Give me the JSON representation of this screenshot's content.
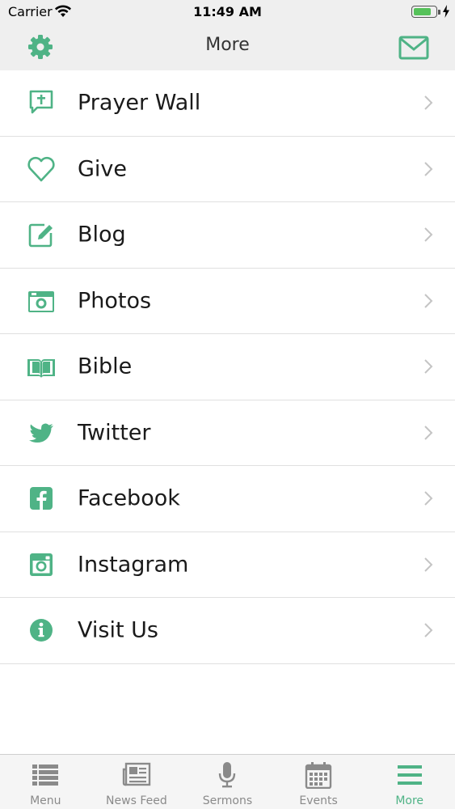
{
  "status_bar": {
    "carrier": "Carrier",
    "time": "11:49 AM",
    "battery_level": 0.7
  },
  "nav": {
    "title": "More",
    "left_icon": "gear-icon",
    "right_icon": "mail-icon"
  },
  "colors": {
    "accent": "#4fb386",
    "inactive": "#8a8a8a",
    "chevron": "#c4c4c4",
    "bar_bg": "#efefef"
  },
  "list": {
    "items": [
      {
        "label": "Prayer Wall",
        "icon": "prayer-bubble-icon"
      },
      {
        "label": "Give",
        "icon": "heart-icon"
      },
      {
        "label": "Blog",
        "icon": "edit-pencil-icon"
      },
      {
        "label": "Photos",
        "icon": "camera-icon"
      },
      {
        "label": "Bible",
        "icon": "book-icon"
      },
      {
        "label": "Twitter",
        "icon": "twitter-bird-icon"
      },
      {
        "label": "Facebook",
        "icon": "facebook-icon"
      },
      {
        "label": "Instagram",
        "icon": "instagram-icon"
      },
      {
        "label": "Visit Us",
        "icon": "info-icon"
      }
    ]
  },
  "tabs": [
    {
      "label": "Menu",
      "icon": "list-icon",
      "active": false
    },
    {
      "label": "News Feed",
      "icon": "newspaper-icon",
      "active": false
    },
    {
      "label": "Sermons",
      "icon": "microphone-icon",
      "active": false
    },
    {
      "label": "Events",
      "icon": "calendar-icon",
      "active": false
    },
    {
      "label": "More",
      "icon": "hamburger-icon",
      "active": true
    }
  ]
}
